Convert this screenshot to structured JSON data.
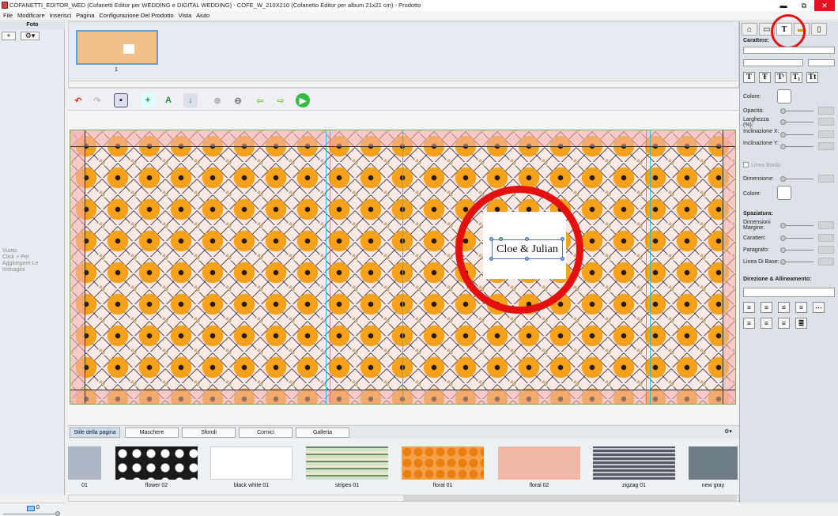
{
  "window": {
    "title": "COFANETTI_EDITOR_WED (Cofanetti Editor per WEDDING e DIGITAL WEDDING) - COFE_W_210X210 (Cofanetto Editor per album 21x21 cm) - Prodotto",
    "min": "▬",
    "max": "⧉",
    "close": "✕"
  },
  "menu": [
    "File",
    "Modificare",
    "Inserisci",
    "Pagina",
    "Configurazione Del Prodotto",
    "Vista",
    "Aiuto"
  ],
  "left": {
    "header": "Foto",
    "add": "+",
    "gear": "⚙▾",
    "empty_line1": "Vuoto",
    "empty_line2": "Click + Per",
    "empty_line3": "Aggiungere Le",
    "empty_line4": "Immagini",
    "count": "0"
  },
  "pages": {
    "thumb_num": "1"
  },
  "canvas": {
    "text": "Cloe & Julian"
  },
  "tabs": [
    "Stile della pagina",
    "Maschere",
    "Sfondi",
    "Cornici",
    "Galleria"
  ],
  "styles": [
    {
      "label": "01",
      "bg": "#aeb8c4"
    },
    {
      "label": "flower 02",
      "bg": "#1a1a1a"
    },
    {
      "label": "black white 01",
      "bg": "#ffffff"
    },
    {
      "label": "stripes 01",
      "bg": "#cfe1c8"
    },
    {
      "label": "floral 01",
      "bg": "#f5a24a"
    },
    {
      "label": "floral 02",
      "bg": "#f1b7a7"
    },
    {
      "label": "zigzag 01",
      "bg": "#555a66"
    },
    {
      "label": "new gray",
      "bg": "#6e7c86"
    }
  ],
  "right": {
    "carattere": "Carattere:",
    "colore": "Colore:",
    "opacita": "Opacità:",
    "larghezza": "Larghezza (%):",
    "inclin_x": "Inclinazione X:",
    "inclin_y": "Inclinazione Y:",
    "linea_bordo": "Linea Bordo",
    "dimensione": "Dimensione:",
    "colore2": "Colore:",
    "spaziatura": "Spaziatura:",
    "dim_margine": "Dimensioni Margine:",
    "caratteri": "Caratteri:",
    "paragrafo": "Paragrafo:",
    "linea_base": "Linea Di Base:",
    "direzione": "Direzione & Allineamento:",
    "font_buttons": [
      "T",
      "Ŧ",
      "Tᵗ",
      "T₁",
      "Tt"
    ]
  }
}
